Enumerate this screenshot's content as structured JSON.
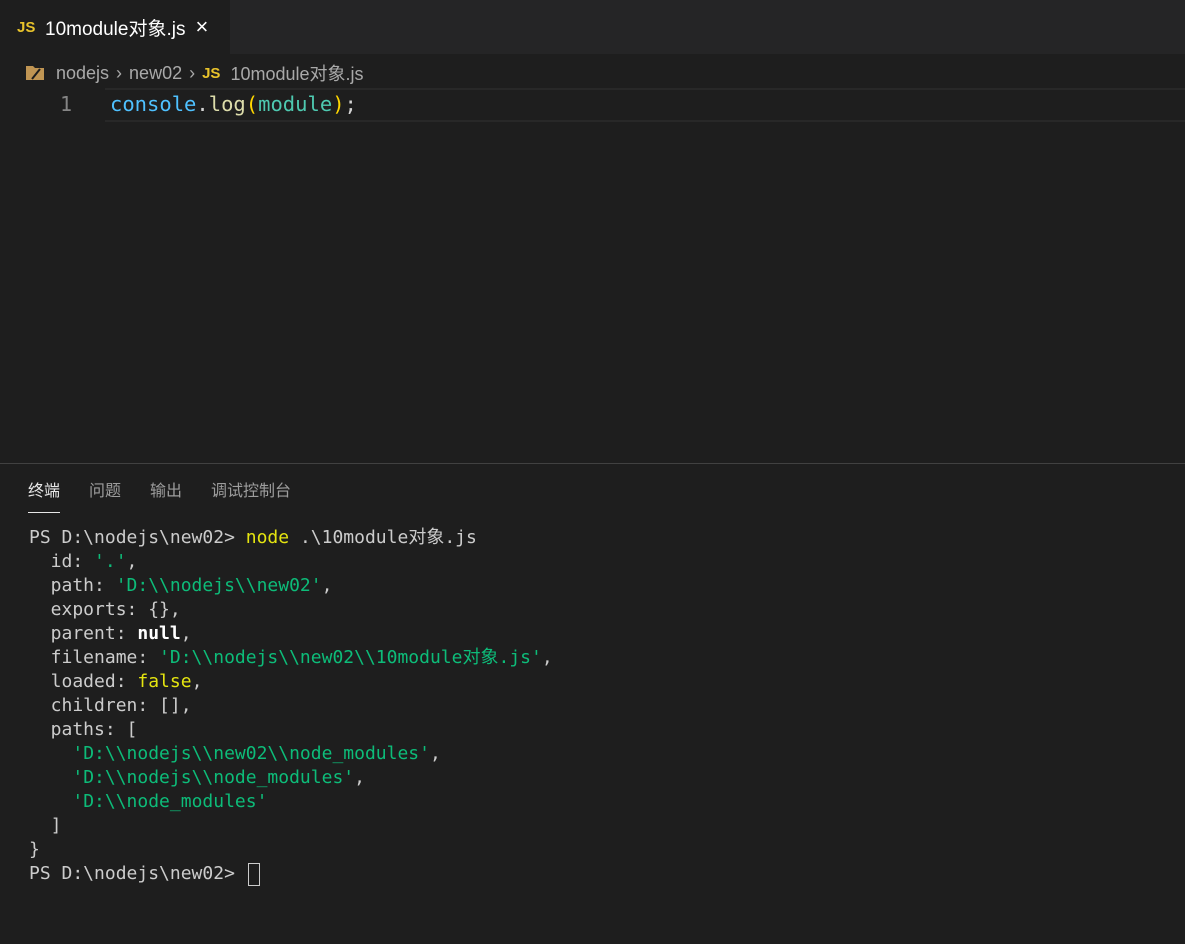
{
  "tab": {
    "badge": "JS",
    "name": "10module对象.js",
    "close_icon": "×"
  },
  "breadcrumb": {
    "items": [
      "nodejs",
      "new02"
    ],
    "file_badge": "JS",
    "file": "10module对象.js"
  },
  "editor": {
    "line_number": "1",
    "code": {
      "obj": "console",
      "dot": ".",
      "fn": "log",
      "open": "(",
      "arg": "module",
      "close": ")",
      "semi": ";"
    }
  },
  "panel": {
    "tabs": [
      "终端",
      "问题",
      "输出",
      "调试控制台"
    ],
    "active_tab": "终端"
  },
  "terminal": {
    "prompt": "PS D:\\nodejs\\new02> ",
    "command": "node",
    "command_args": " .\\10module对象.js",
    "output": [
      {
        "parts": [
          {
            "t": "  id: ",
            "c": ""
          },
          {
            "t": "'.'",
            "c": "str"
          },
          {
            "t": ",",
            "c": ""
          }
        ]
      },
      {
        "parts": [
          {
            "t": "  path: ",
            "c": ""
          },
          {
            "t": "'D:\\\\nodejs\\\\new02'",
            "c": "str"
          },
          {
            "t": ",",
            "c": ""
          }
        ]
      },
      {
        "parts": [
          {
            "t": "  exports: {},",
            "c": ""
          }
        ]
      },
      {
        "parts": [
          {
            "t": "  parent: ",
            "c": ""
          },
          {
            "t": "null",
            "c": "bold"
          },
          {
            "t": ",",
            "c": ""
          }
        ]
      },
      {
        "parts": [
          {
            "t": "  filename: ",
            "c": ""
          },
          {
            "t": "'D:\\\\nodejs\\\\new02\\\\10module对象.js'",
            "c": "str"
          },
          {
            "t": ",",
            "c": ""
          }
        ]
      },
      {
        "parts": [
          {
            "t": "  loaded: ",
            "c": ""
          },
          {
            "t": "false",
            "c": "yel"
          },
          {
            "t": ",",
            "c": ""
          }
        ]
      },
      {
        "parts": [
          {
            "t": "  children: [],",
            "c": ""
          }
        ]
      },
      {
        "parts": [
          {
            "t": "  paths: [",
            "c": ""
          }
        ]
      },
      {
        "parts": [
          {
            "t": "    ",
            "c": ""
          },
          {
            "t": "'D:\\\\nodejs\\\\new02\\\\node_modules'",
            "c": "str"
          },
          {
            "t": ",",
            "c": ""
          }
        ]
      },
      {
        "parts": [
          {
            "t": "    ",
            "c": ""
          },
          {
            "t": "'D:\\\\nodejs\\\\node_modules'",
            "c": "str"
          },
          {
            "t": ",",
            "c": ""
          }
        ]
      },
      {
        "parts": [
          {
            "t": "    ",
            "c": ""
          },
          {
            "t": "'D:\\\\node_modules'",
            "c": "str"
          }
        ]
      },
      {
        "parts": [
          {
            "t": "  ]",
            "c": ""
          }
        ]
      },
      {
        "parts": [
          {
            "t": "}",
            "c": ""
          }
        ]
      }
    ],
    "final_prompt": "PS D:\\nodejs\\new02> "
  },
  "colors": {
    "js_badge": "#e8c32b",
    "string": "#0dbc79",
    "keyword_yellow": "#e5e510"
  }
}
